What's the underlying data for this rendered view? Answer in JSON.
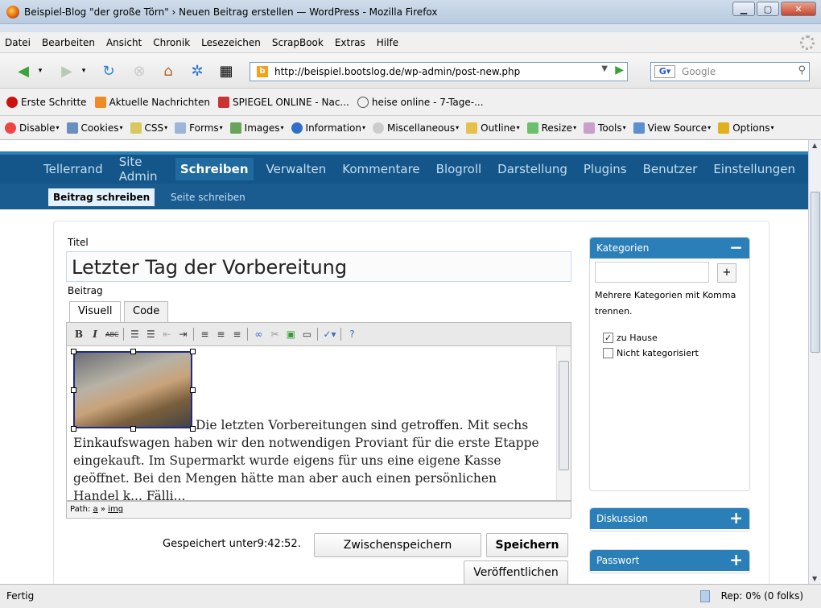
{
  "window": {
    "title": "Beispiel-Blog \"der große Törn\" › Neuen Beitrag erstellen — WordPress - Mozilla Firefox"
  },
  "menu": [
    "Datei",
    "Bearbeiten",
    "Ansicht",
    "Chronik",
    "Lesezeichen",
    "ScrapBook",
    "Extras",
    "Hilfe"
  ],
  "nav": {
    "url": "http://beispiel.bootslog.de/wp-admin/post-new.php",
    "search_placeholder": "Google"
  },
  "bookmarks": [
    "Erste Schritte",
    "Aktuelle Nachrichten",
    "SPIEGEL ONLINE - Nac...",
    "heise online - 7-Tage-..."
  ],
  "devtoolbar": [
    "Disable",
    "Cookies",
    "CSS",
    "Forms",
    "Images",
    "Information",
    "Miscellaneous",
    "Outline",
    "Resize",
    "Tools",
    "View Source",
    "Options"
  ],
  "wp": {
    "menu": [
      "Tellerrand",
      "Site Admin",
      "Schreiben",
      "Verwalten",
      "Kommentare",
      "Blogroll",
      "Darstellung",
      "Plugins",
      "Benutzer",
      "Einstellungen"
    ],
    "submenu": [
      "Beitrag schreiben",
      "Seite schreiben"
    ],
    "title_label": "Titel",
    "title_value": "Letzter Tag der Vorbereitung",
    "content_label": "Beitrag",
    "tabs": [
      "Visuell",
      "Code"
    ],
    "body_lines": [
      "Die letzten Vorbereitungen sind getroffen. Mit sechs",
      "Einkaufswagen haben wir den notwendigen Proviant für die erste Etappe",
      "eingekauft. Im Supermarkt wurde eigens für uns eine eigene Kasse",
      "geöffnet. Bei den Mengen hätte man aber auch einen persönlichen",
      "Handel k... Fälli... "
    ],
    "path_label": "Path:",
    "path_a": "a",
    "path_sep": "»",
    "path_img": "img",
    "saved_text": "Gespeichert unter9:42:52.",
    "btn_draft": "Zwischenspeichern",
    "btn_save": "Speichern",
    "btn_publish": "Veröffentlichen",
    "categories": {
      "title": "Kategorien",
      "toggle": "−",
      "plus": "+",
      "hint": "Mehrere Kategorien mit Komma trennen.",
      "items": [
        {
          "label": "zu Hause",
          "checked": "✓"
        },
        {
          "label": "Nicht kategorisiert",
          "checked": ""
        }
      ]
    },
    "discussion": {
      "title": "Diskussion",
      "toggle": "+"
    },
    "password": {
      "title": "Passwort",
      "toggle": "+"
    }
  },
  "status": {
    "text": "Fertig",
    "rep": "Rep: 0% (0 folks)"
  }
}
